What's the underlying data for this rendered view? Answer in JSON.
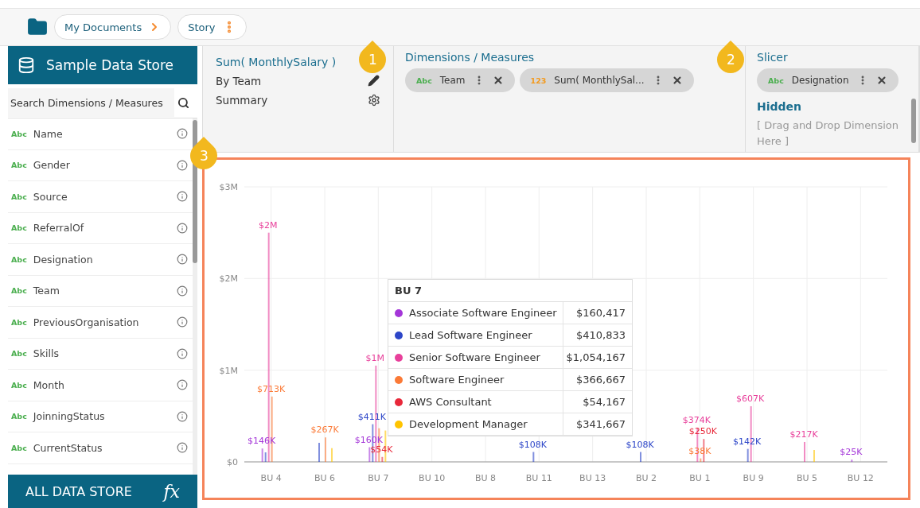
{
  "breadcrumb": {
    "items": [
      {
        "label": "My Documents"
      },
      {
        "label": "Story"
      }
    ]
  },
  "sidebar": {
    "title": "Sample Data Store",
    "search": {
      "placeholder": "Search Dimensions / Measures"
    },
    "items": [
      {
        "type_label": "Abc",
        "label": "Name"
      },
      {
        "type_label": "Abc",
        "label": "Gender"
      },
      {
        "type_label": "Abc",
        "label": "Source"
      },
      {
        "type_label": "Abc",
        "label": "ReferralOf"
      },
      {
        "type_label": "Abc",
        "label": "Designation"
      },
      {
        "type_label": "Abc",
        "label": "Team"
      },
      {
        "type_label": "Abc",
        "label": "PreviousOrganisation"
      },
      {
        "type_label": "Abc",
        "label": "Skills"
      },
      {
        "type_label": "Abc",
        "label": "Month"
      },
      {
        "type_label": "Abc",
        "label": "JoinningStatus"
      },
      {
        "type_label": "Abc",
        "label": "CurrentStatus"
      }
    ],
    "footer": {
      "label": "ALL DATA STORE",
      "formula_label": "fx"
    }
  },
  "summary_panel": {
    "title": "Sum( MonthlySalary )",
    "subtitle": "By Team",
    "summary": "Summary"
  },
  "dimensions_panel": {
    "badge": "1",
    "title": "Dimensions / Measures",
    "chips": [
      {
        "kind": "dimension",
        "type_label": "Abc",
        "label": "Team"
      },
      {
        "kind": "measure",
        "type_label": "123",
        "label": "Sum( MonthlySal..."
      }
    ]
  },
  "slicer_panel": {
    "badge": "2",
    "title": "Slicer",
    "chips": [
      {
        "kind": "dimension",
        "type_label": "Abc",
        "label": "Designation"
      }
    ],
    "hidden_title": "Hidden",
    "hidden_placeholder": "[ Drag and Drop Dimension Here ]"
  },
  "chart_panel": {
    "badge": "3",
    "chart_data": {
      "type": "bar",
      "grid": true,
      "categories": [
        "BU 4",
        "BU 6",
        "BU 7",
        "BU 10",
        "BU 8",
        "BU 11",
        "BU 13",
        "BU 2",
        "BU 1",
        "BU 9",
        "BU 5",
        "BU 12"
      ],
      "ylim": [
        0,
        3000000
      ],
      "yticks": [
        {
          "value": 0,
          "label": "$0"
        },
        {
          "value": 1000000,
          "label": "$1M"
        },
        {
          "value": 2000000,
          "label": "$2M"
        },
        {
          "value": 3000000,
          "label": "$3M"
        }
      ],
      "series": [
        {
          "name": "Associate Software Engineer",
          "color": "#a436d8",
          "values": [
            146000,
            null,
            160000,
            null,
            null,
            null,
            null,
            null,
            null,
            null,
            null,
            25000
          ],
          "value_labels": [
            "$146K",
            null,
            "$160K",
            null,
            null,
            null,
            null,
            null,
            null,
            null,
            null,
            "$25K"
          ]
        },
        {
          "name": "Lead Software Engineer",
          "color": "#2d46c8",
          "values": [
            104000,
            208000,
            411000,
            null,
            null,
            108000,
            null,
            108000,
            null,
            142000,
            null,
            null
          ],
          "value_labels": [
            null,
            null,
            "$411K",
            null,
            null,
            "$108K",
            null,
            "$108K",
            null,
            "$142K",
            null,
            null
          ]
        },
        {
          "name": "Senior Software Engineer",
          "color": "#e8409b",
          "values": [
            2500000,
            null,
            1050000,
            null,
            null,
            null,
            null,
            null,
            374000,
            607000,
            217000,
            null
          ],
          "value_labels": [
            "$2M",
            null,
            "$1M",
            null,
            null,
            null,
            null,
            null,
            "$374K",
            "$607K",
            "$217K",
            null
          ]
        },
        {
          "name": "Software Engineer",
          "color": "#fb7a37",
          "values": [
            713000,
            267000,
            367000,
            null,
            null,
            null,
            null,
            null,
            38000,
            null,
            null,
            null
          ],
          "value_labels": [
            "$713K",
            "$267K",
            null,
            null,
            null,
            null,
            null,
            null,
            "$38K",
            null,
            null,
            null
          ]
        },
        {
          "name": "AWS Consultant",
          "color": "#e8283a",
          "values": [
            null,
            null,
            54000,
            null,
            null,
            null,
            null,
            null,
            250000,
            null,
            null,
            null
          ],
          "value_labels": [
            null,
            null,
            "$54K",
            null,
            null,
            null,
            null,
            null,
            "$250K",
            null,
            null,
            null
          ]
        },
        {
          "name": "Development Manager",
          "color": "#ffc400",
          "values": [
            null,
            150000,
            342000,
            null,
            null,
            null,
            null,
            null,
            null,
            null,
            130000,
            null
          ]
        }
      ]
    },
    "tooltip": {
      "title": "BU 7",
      "values": [
        "$160,417",
        "$410,833",
        "$1,054,167",
        "$366,667",
        "$54,167",
        "$341,667"
      ]
    }
  }
}
